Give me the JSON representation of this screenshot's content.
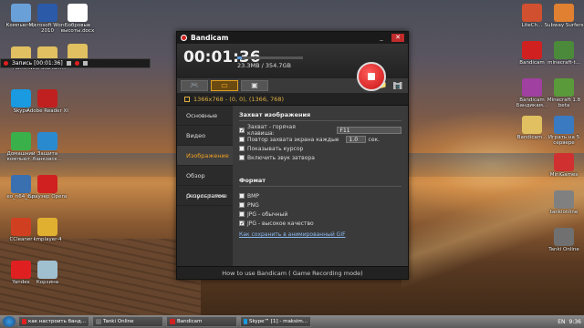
{
  "desktop": {
    "left_icons": [
      {
        "label": "Компьютер",
        "icon": "computer-icon",
        "color": "#6aa0d8"
      },
      {
        "label": "Admin",
        "icon": "folder-icon",
        "color": "#e0c060"
      },
      {
        "label": "Skype",
        "icon": "skype-icon",
        "color": "#1a9ae0"
      },
      {
        "label": "Домашний компьют...",
        "icon": "homegroup-icon",
        "color": "#3ab04a"
      },
      {
        "label": "eo_n64_rus",
        "icon": "emulator-icon",
        "color": "#3a70b0"
      },
      {
        "label": "CCleaner",
        "icon": "ccleaner-icon",
        "color": "#d04020"
      },
      {
        "label": "Yandex",
        "icon": "yandex-icon",
        "color": "#e02020"
      }
    ],
    "second_col_icons": [
      {
        "label": "Microsoft Word 2010",
        "icon": "word-icon",
        "color": "#2a5aa8"
      },
      {
        "label": "New StartSm...",
        "icon": "folder-icon",
        "color": "#e0c060"
      },
      {
        "label": "Adobe Reader XI",
        "icon": "pdf-icon",
        "color": "#c02020"
      },
      {
        "label": "Защита банковск...",
        "icon": "shield-icon",
        "color": "#2a8ad0"
      },
      {
        "label": "Браузер Opera",
        "icon": "opera-icon",
        "color": "#d02020"
      },
      {
        "label": "kmplayer-4",
        "icon": "kmplayer-icon",
        "color": "#e0b030"
      },
      {
        "label": "Корзина",
        "icon": "recycle-bin-icon",
        "color": "#a0c0d0"
      }
    ],
    "third_col_icons": [
      {
        "label": "Бобровые высоты.docx",
        "icon": "doc-icon",
        "color": "#ffffff"
      },
      {
        "label": "Без",
        "icon": "folder-icon",
        "color": "#e0c060"
      }
    ],
    "right_icons": [
      {
        "label": "LiteCh...",
        "icon": "app-icon",
        "color": "#d05030"
      },
      {
        "label": "Subway Surfers",
        "icon": "game-icon",
        "color": "#e08030"
      },
      {
        "label": "Bandicam",
        "icon": "bandicam-icon",
        "color": "#d02020"
      },
      {
        "label": "minecraft-t...",
        "icon": "minecraft-icon",
        "color": "#4a8a3a"
      },
      {
        "label": "Bandicam Бандикам...",
        "icon": "winrar-icon",
        "color": "#a040a0"
      },
      {
        "label": "Minecraft 1.8 beta",
        "icon": "minecraft-icon",
        "color": "#5a9a3a"
      },
      {
        "label": "Bandicam...",
        "icon": "folder-icon",
        "color": "#e0c060"
      },
      {
        "label": "Играть на 5 сервере",
        "icon": "game-icon",
        "color": "#3a7ac0"
      },
      {
        "label": "MiniGames",
        "icon": "minigames-icon",
        "color": "#d03030"
      },
      {
        "label": "tankionline",
        "icon": "tanki-icon",
        "color": "#808080"
      },
      {
        "label": "Tanki Online",
        "icon": "tanki-icon",
        "color": "#707070"
      }
    ]
  },
  "recbar": {
    "label": "Запись [00:01:36]"
  },
  "bandicam": {
    "title": "Bandicam",
    "timer": "00:01:36",
    "file_size": "23.3MB / 354.7GB",
    "progress": 0.07,
    "area_text": "1366x768 - (0, 0), (1366, 768)",
    "sidebar": [
      "Основные",
      "Видео",
      "Изображение",
      "Обзор результатов",
      "О программе"
    ],
    "active_index": 2,
    "capture_section": "Захват изображения",
    "capture_rows": [
      {
        "label": "Захват - горячая клавиша:",
        "checked": true,
        "value": "F11"
      },
      {
        "label": "Повтор захвата экрана каждые",
        "checked": false,
        "value": "1.0",
        "suffix": "сек."
      },
      {
        "label": "Показывать курсор",
        "checked": false
      },
      {
        "label": "Включить звук затвора",
        "checked": false
      }
    ],
    "format_section": "Формат",
    "format_rows": [
      {
        "label": "BMP",
        "checked": false
      },
      {
        "label": "PNG",
        "checked": false
      },
      {
        "label": "JPG - обычный",
        "checked": false
      },
      {
        "label": "JPG - высокое качество",
        "checked": true
      }
    ],
    "gif_link": "Как сохранить в анимированный GIF",
    "footer": "How to use Bandicam ( Game Recording  mode)"
  },
  "taskbar": {
    "tasks": [
      {
        "label": "как настроить банд...",
        "color": "#e02020"
      },
      {
        "label": "Tanki Online",
        "color": "#707070"
      },
      {
        "label": "Bandicam",
        "color": "#d02020"
      },
      {
        "label": "Skype™ [1] - maksim...",
        "color": "#1a9ae0"
      }
    ],
    "lang": "EN",
    "time": "9:36"
  }
}
